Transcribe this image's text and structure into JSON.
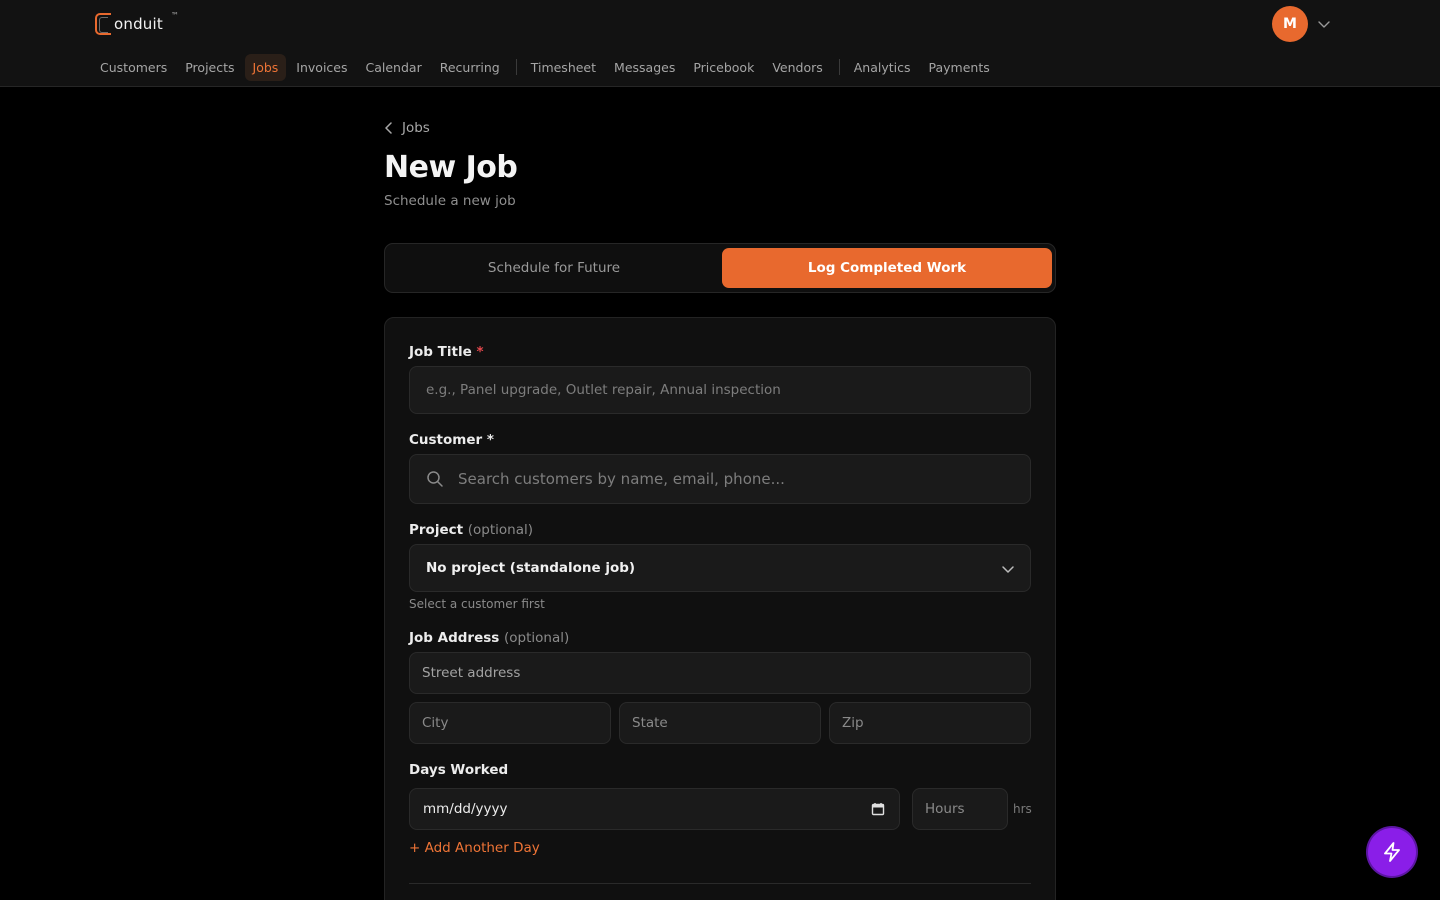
{
  "brand": {
    "name": "onduit",
    "tm": "™"
  },
  "user": {
    "initial": "M"
  },
  "nav": {
    "customers": "Customers",
    "projects": "Projects",
    "jobs": "Jobs",
    "invoices": "Invoices",
    "calendar": "Calendar",
    "recurring": "Recurring",
    "timesheet": "Timesheet",
    "messages": "Messages",
    "pricebook": "Pricebook",
    "vendors": "Vendors",
    "analytics": "Analytics",
    "payments": "Payments",
    "active": "Jobs"
  },
  "breadcrumb": {
    "label": "Jobs"
  },
  "page": {
    "title": "New Job",
    "subtitle": "Schedule a new job"
  },
  "mode_toggle": {
    "left": "Schedule for Future",
    "right": "Log Completed Work",
    "selected": "Log Completed Work"
  },
  "form": {
    "job_title": {
      "label": "Job Title",
      "required_mark": "*",
      "placeholder": "e.g., Panel upgrade, Outlet repair, Annual inspection",
      "value": ""
    },
    "customer": {
      "label": "Customer *",
      "placeholder": "Search customers by name, email, phone...",
      "value": ""
    },
    "project": {
      "label": "Project",
      "optional": "(optional)",
      "value": "No project (standalone job)",
      "hint": "Select a customer first"
    },
    "job_address": {
      "label": "Job Address",
      "optional": "(optional)",
      "street_placeholder": "Street address",
      "city_placeholder": "City",
      "state_placeholder": "State",
      "zip_placeholder": "Zip"
    },
    "days_worked": {
      "label": "Days Worked",
      "date_placeholder": "mm/dd/yyyy",
      "hours_placeholder": "Hours",
      "hours_unit": "hrs",
      "add_day": "+ Add Another Day"
    }
  },
  "colors": {
    "accent": "#e8692e",
    "fab": "#8a1ee8",
    "background": "#000000"
  },
  "icons": [
    "logo-icon",
    "chevron-down-icon",
    "chevron-left-icon",
    "search-icon",
    "calendar-icon",
    "lightning-icon"
  ]
}
